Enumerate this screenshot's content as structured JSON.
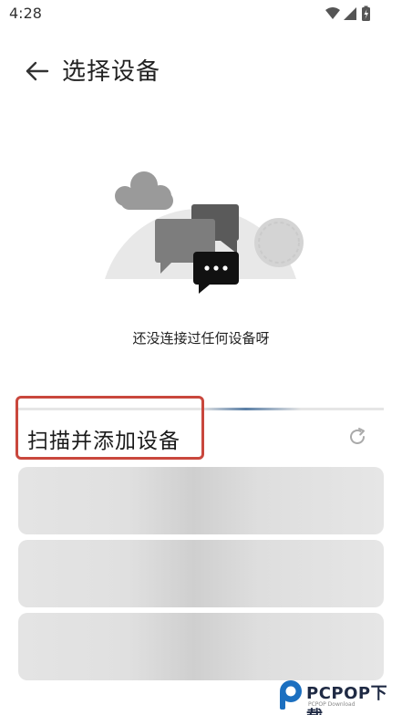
{
  "status_bar": {
    "time": "4:28",
    "icons": [
      "wifi-icon",
      "signal-icon",
      "battery-charging-icon"
    ]
  },
  "header": {
    "back_icon": "arrow-left-icon",
    "title": "选择设备"
  },
  "empty_state": {
    "illustration": "chat-bubbles-cloud-illustration",
    "message": "还没连接过任何设备呀"
  },
  "scan_section": {
    "title": "扫描并添加设备",
    "refresh_icon": "refresh-icon",
    "highlight_color": "#c9473d"
  },
  "device_list": {
    "placeholders": [
      "skeleton-card",
      "skeleton-card",
      "skeleton-card"
    ]
  },
  "watermark": {
    "brand": "PCPOP下载",
    "tagline": "PCPOP Download"
  }
}
